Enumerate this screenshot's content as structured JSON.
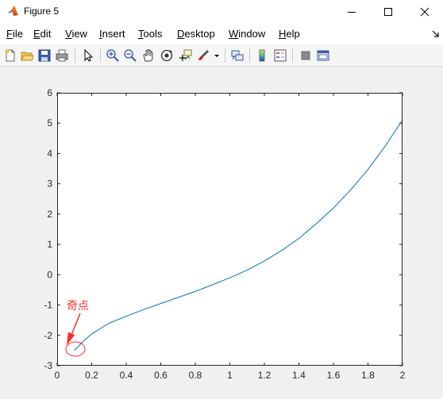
{
  "window": {
    "title": "Figure 5",
    "app_icon": "matlab-icon",
    "controls": [
      "minimize-icon",
      "maximize-icon",
      "close-icon"
    ]
  },
  "menu": {
    "items": [
      {
        "key": "F",
        "rest": "ile"
      },
      {
        "key": "E",
        "rest": "dit"
      },
      {
        "key": "V",
        "rest": "iew"
      },
      {
        "key": "I",
        "rest": "nsert"
      },
      {
        "key": "T",
        "rest": "ools"
      },
      {
        "key": "D",
        "rest": "esktop"
      },
      {
        "key": "W",
        "rest": "indow"
      },
      {
        "key": "H",
        "rest": "elp"
      }
    ],
    "dock_icon": "dock-arrow-icon"
  },
  "toolbar": {
    "icons": [
      "new-figure-icon",
      "open-file-icon",
      "save-icon",
      "print-icon",
      "edit-plot-arrow-icon",
      "zoom-in-icon",
      "zoom-out-icon",
      "pan-hand-icon",
      "rotate-3d-icon",
      "data-cursor-icon",
      "brush-icon",
      "link-plot-icon",
      "colorbar-icon",
      "legend-icon",
      "hide-plot-tools-icon",
      "show-plot-tools-icon"
    ]
  },
  "colors": {
    "line": "#0072bd",
    "annotation": "#ff2b2b",
    "axes": "#262626"
  },
  "annotation": {
    "text": "奇点"
  },
  "chart_data": {
    "type": "line",
    "title": "",
    "xlabel": "",
    "ylabel": "",
    "xlim": [
      0,
      2
    ],
    "ylim": [
      -3,
      6
    ],
    "xticks": [
      0,
      0.2,
      0.4,
      0.6,
      0.8,
      1,
      1.2,
      1.4,
      1.6,
      1.8,
      2
    ],
    "xtick_labels": [
      "0",
      "0.2",
      "0.4",
      "0.6",
      "0.8",
      "1",
      "1.2",
      "1.4",
      "1.6",
      "1.8",
      "2"
    ],
    "yticks": [
      -3,
      -2,
      -1,
      0,
      1,
      2,
      3,
      4,
      5,
      6
    ],
    "ytick_labels": [
      "-3",
      "-2",
      "-1",
      "0",
      "1",
      "2",
      "3",
      "4",
      "5",
      "6"
    ],
    "grid": false,
    "series": [
      {
        "x": [
          0.1,
          0.15,
          0.2,
          0.3,
          0.4,
          0.5,
          0.6,
          0.7,
          0.8,
          0.9,
          1.0,
          1.1,
          1.2,
          1.3,
          1.4,
          1.5,
          1.6,
          1.7,
          1.8,
          1.9,
          2.0
        ],
        "y": [
          -2.5,
          -2.2,
          -1.95,
          -1.6,
          -1.37,
          -1.15,
          -0.95,
          -0.75,
          -0.55,
          -0.33,
          -0.1,
          0.15,
          0.45,
          0.8,
          1.2,
          1.68,
          2.2,
          2.8,
          3.47,
          4.25,
          5.1
        ]
      }
    ]
  }
}
